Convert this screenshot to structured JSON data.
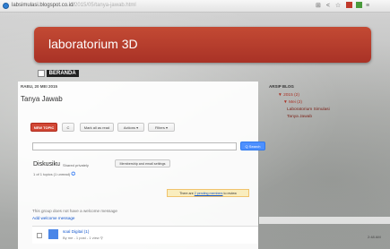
{
  "browser": {
    "url": "labsimulasi.blogspot.co.id/",
    "url_rest": "2015/05/tanya-jawab.html",
    "toolbar_icons": [
      "bookmark-icon",
      "share-icon",
      "star-icon",
      "extension-icon",
      "menu-icon"
    ]
  },
  "blog": {
    "title": "laboratorium 3D",
    "nav": {
      "home_label": "BERANDA"
    }
  },
  "post": {
    "date": "RABU, 20 MEI 2015",
    "title": "Tanya Jawab"
  },
  "group": {
    "toolbar": {
      "new_topic": "NEW TOPIC",
      "refresh": "C",
      "mark_read": "Mark all as read",
      "actions": "Actions ▾",
      "filters": "Filters ▾"
    },
    "search_button": "Q Search",
    "name": "Diskusiku",
    "shared": "Shared privately",
    "membership": "Membership and email settings",
    "topics_count": "1 of 1 topics (1 unread)",
    "pending_pre": "There are ",
    "pending_link": "2 pending members",
    "pending_post": " to review",
    "no_welcome": "This group does not have a welcome message",
    "add_welcome": "Add welcome message",
    "topic": {
      "title": "soal Digital",
      "count": "(1)",
      "meta": "By me - 1 post - 1 view"
    }
  },
  "sidebar": {
    "heading": "ARSIP BLOG",
    "year": "▼ 2015 (2)",
    "month": "▼ Mei (2)",
    "posts": [
      "Laboratorium Simulasi",
      "Tanya Jawab"
    ]
  },
  "clock": "2:48 AM",
  "colors": {
    "header_red": "#b83a2b",
    "new_topic_red": "#d14836",
    "search_blue": "#4d90fe",
    "pending_yellow": "#f9edbe"
  }
}
